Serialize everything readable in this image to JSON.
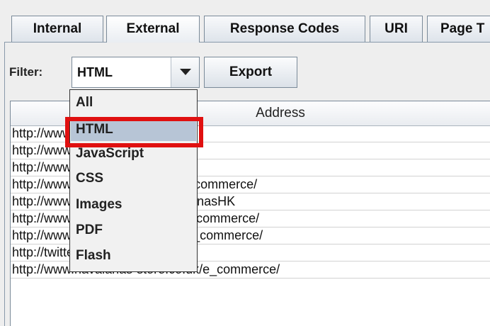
{
  "tabs": [
    "Internal",
    "External",
    "Response Codes",
    "URI",
    "Page T"
  ],
  "active_tab": "External",
  "filter": {
    "label": "Filter:",
    "selected": "HTML",
    "options": [
      "All",
      "HTML",
      "JavaScript",
      "CSS",
      "Images",
      "PDF",
      "Flash"
    ]
  },
  "export_label": "Export",
  "table": {
    "header_address": "Address",
    "rows": [
      "http://www.havaianas.com.br/",
      "http://www.havaianas-store.com/",
      "http://www.havaianas.com.br/",
      "http://www.havaianas-store.fr/e_commerce/",
      "http://www.facebook.com/HavaianasHK",
      "http://www.havaianas-store.ie/e_commerce/",
      "http://www.havaianas-store.es/e_commerce/",
      "http://twitter.com/havaianas",
      "http://www.havaianas-store.co.uk/e_commerce/"
    ]
  },
  "colors": {
    "highlight": "#e01010",
    "selection": "#b7c5d6"
  }
}
